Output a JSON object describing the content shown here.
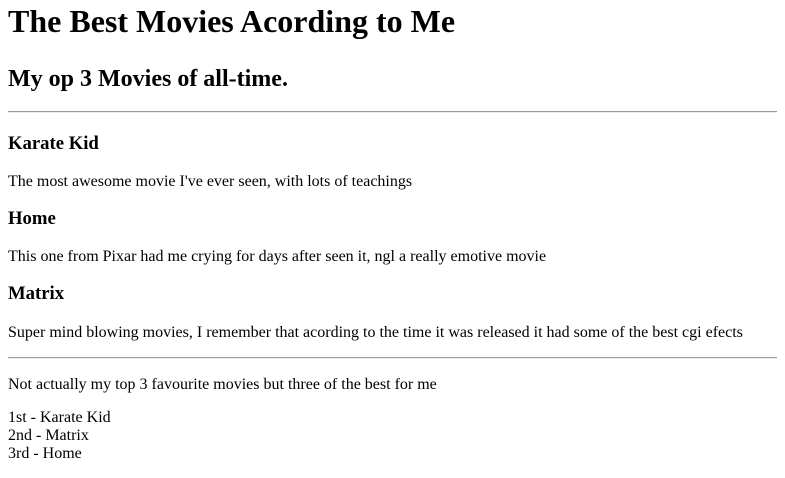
{
  "page": {
    "title": "The Best Movies Acording to Me",
    "subtitle": "My op 3 Movies of all-time."
  },
  "movies": [
    {
      "name": "Karate Kid",
      "description": "The most awesome movie I've ever seen, with lots of teachings"
    },
    {
      "name": "Home",
      "description": "This one from Pixar had me crying for days after seen it, ngl a really emotive movie"
    },
    {
      "name": "Matrix",
      "description": "Super mind blowing movies, I remember that acording to the time it was released it had some of the best cgi efects"
    }
  ],
  "footer": {
    "note": "Not actually my top 3 favourite movies but three of the best for me",
    "ranking": [
      "1st - Karate Kid",
      "2nd - Matrix",
      "3rd - Home"
    ]
  }
}
